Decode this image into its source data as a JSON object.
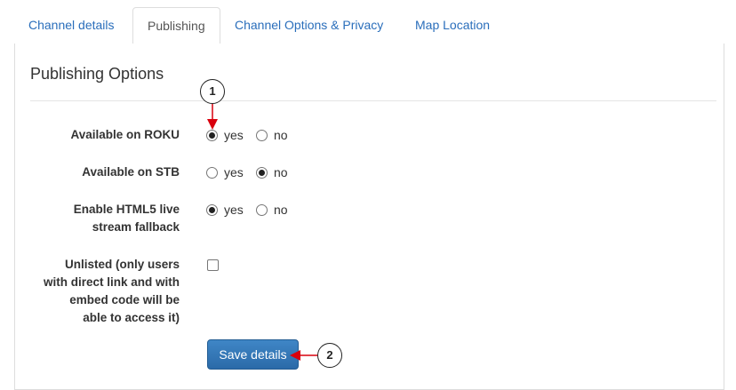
{
  "tabs": [
    {
      "label": "Channel details",
      "active": false
    },
    {
      "label": "Publishing",
      "active": true
    },
    {
      "label": "Channel Options & Privacy",
      "active": false
    },
    {
      "label": "Map Location",
      "active": false
    }
  ],
  "section": {
    "title": "Publishing Options"
  },
  "fields": {
    "roku": {
      "label": "Available on ROKU",
      "yes": "yes",
      "no": "no",
      "selected": "yes"
    },
    "stb": {
      "label": "Available on STB",
      "yes": "yes",
      "no": "no",
      "selected": "no"
    },
    "html5": {
      "label_line1": "Enable HTML5 live",
      "label_line2": "stream fallback",
      "yes": "yes",
      "no": "no",
      "selected": "yes"
    },
    "unlisted": {
      "label_line1": "Unlisted (only users",
      "label_line2": "with direct link and with",
      "label_line3": "embed code will be",
      "label_line4": "able to access it)",
      "checked": false
    }
  },
  "actions": {
    "save_label": "Save details"
  },
  "annotations": {
    "callout1": "1",
    "callout2": "2",
    "arrow_color": "#d9000d"
  },
  "colors": {
    "link": "#2a6ebb",
    "button": "#337ab7"
  }
}
